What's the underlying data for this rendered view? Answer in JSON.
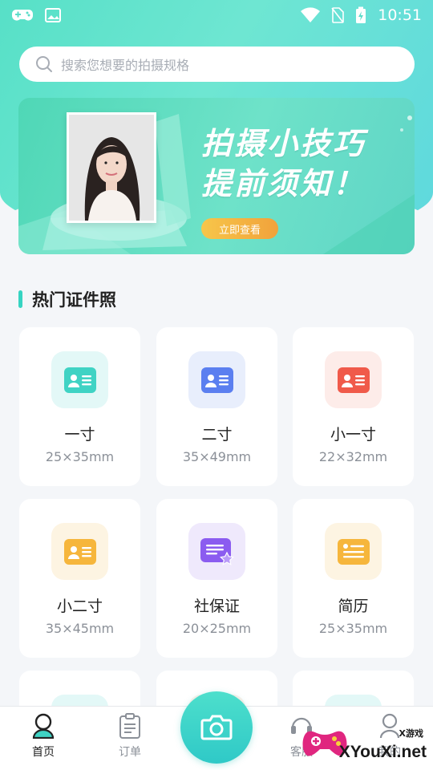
{
  "status_bar": {
    "time": "10:51",
    "left_icons": [
      "gamepad-icon",
      "image-icon"
    ],
    "right_icons": [
      "wifi-icon",
      "no-sim-icon",
      "battery-charging-icon"
    ]
  },
  "search": {
    "placeholder": "搜索您想要的拍摄规格"
  },
  "banner": {
    "headline_line1": "拍摄小技巧",
    "headline_line2": "提前须知！",
    "cta_label": "立即查看"
  },
  "section": {
    "title": "热门证件照"
  },
  "cards": [
    {
      "name": "一寸",
      "size": "25×35mm",
      "bg": "#e3f8f7",
      "color": "#3fd3c4",
      "icon": "id-card-icon"
    },
    {
      "name": "二寸",
      "size": "35×49mm",
      "bg": "#e8eefc",
      "color": "#5b7ff0",
      "icon": "id-card-icon"
    },
    {
      "name": "小一寸",
      "size": "22×32mm",
      "bg": "#fdece9",
      "color": "#f05a4a",
      "icon": "id-card-icon"
    },
    {
      "name": "小二寸",
      "size": "35×45mm",
      "bg": "#fdf4e2",
      "color": "#f6b63c",
      "icon": "id-card-icon"
    },
    {
      "name": "社保证",
      "size": "20×25mm",
      "bg": "#efe9fc",
      "color": "#8b5cf0",
      "icon": "document-star-icon"
    },
    {
      "name": "简历",
      "size": "25×35mm",
      "bg": "#fdf4e2",
      "color": "#f6b63c",
      "icon": "resume-icon"
    }
  ],
  "tabbar": {
    "home_label": "首页",
    "orders_label": "订单",
    "service_label": "客服",
    "profile_label": "我的"
  },
  "watermark": {
    "small": "X游戏",
    "large": "XYouXi.net"
  },
  "colors": {
    "accent": "#3fd3c4",
    "text": "#222222",
    "muted": "#8b9098"
  }
}
